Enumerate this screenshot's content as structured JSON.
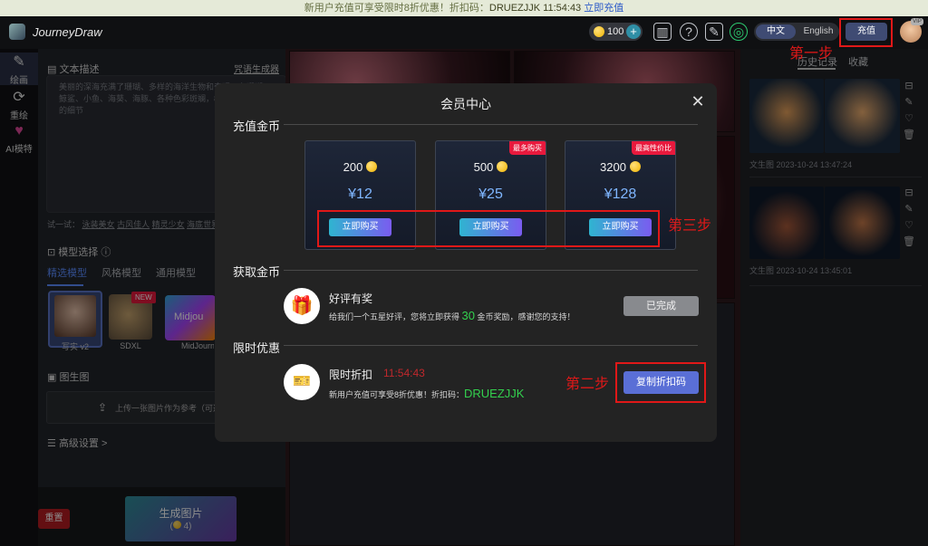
{
  "banner": {
    "text": "新用户充值可享受限时8折优惠！折扣码：",
    "code": "DRUEZJJK",
    "time": "11:54:43",
    "link": "立即充值"
  },
  "header": {
    "app_name": "JourneyDraw",
    "coins": "100",
    "plus": "+",
    "lang_zh": "中文",
    "lang_en": "English",
    "recharge_label": "充值",
    "vip_badge": "VIP",
    "step1_label": "第一步"
  },
  "leftnav": {
    "items": [
      {
        "label": "绘画"
      },
      {
        "label": "重绘"
      },
      {
        "label": "AI模特"
      }
    ]
  },
  "panel": {
    "text_desc_title": "文本描述",
    "spell_generator": "咒语生成器",
    "prompt_text": "美丽的深海充满了珊瑚、多样的海洋生物和奇观，有珊瑚、鲸鲨、小鱼、海葵、海豚、各种色彩斑斓，8k分辨率和复杂的细节",
    "try_label": "试一试：",
    "try_items": [
      "泳装美女",
      "古风佳人",
      "精灵少女",
      "海底世界"
    ],
    "model_select_title": "模型选择",
    "model_tabs": [
      "精选模型",
      "风格模型",
      "通用模型"
    ],
    "models": [
      {
        "label": "写实 v2"
      },
      {
        "label": "SDXL"
      },
      {
        "label": "MidJourney",
        "thumb_text": "Midjou"
      }
    ],
    "new_badge": "NEW",
    "img2img_title": "图生图",
    "upload_text": "上传一张图片作为参考（可选）",
    "advanced": "高级设置 >",
    "reset": "重置",
    "generate": "生成图片",
    "generate_cost": "4"
  },
  "history": {
    "tabs": [
      "历史记录",
      "收藏"
    ],
    "items": [
      {
        "meta": "文生图 2023-10-24 13:47:24"
      },
      {
        "meta": "文生图 2023-10-24 13:45:01"
      }
    ]
  },
  "modal": {
    "title": "会员中心",
    "recharge_section": "充值金币",
    "cards": [
      {
        "coins": "200",
        "price": "¥12",
        "buy": "立即购买",
        "tag": ""
      },
      {
        "coins": "500",
        "price": "¥25",
        "buy": "立即购买",
        "tag": "最多购买"
      },
      {
        "coins": "3200",
        "price": "¥128",
        "buy": "立即购买",
        "tag": "最高性价比"
      }
    ],
    "step3_label": "第三步",
    "earn_section": "获取金币",
    "review_title": "好评有奖",
    "review_desc_pre": "给我们一个五星好评，您将立即获得",
    "review_amount": "30",
    "review_desc_post": "金币奖励，感谢您的支持！",
    "done_label": "已完成",
    "promo_section": "限时优惠",
    "discount_title": "限时折扣",
    "discount_time": "11:54:43",
    "discount_desc": "新用户充值可享受8折优惠！折扣码：",
    "discount_code": "DRUEZJJK",
    "step2_label": "第二步",
    "copy_label": "复制折扣码"
  },
  "colors": {
    "accent": "#3f4b73",
    "price": "#7fb6ff",
    "code_green": "#33d14e",
    "annotation_red": "#e01818",
    "tag_red": "#e8193d"
  }
}
